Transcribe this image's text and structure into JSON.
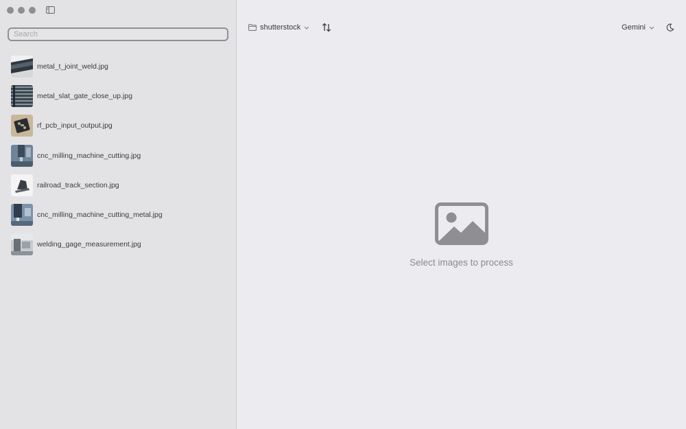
{
  "window": {
    "traffic_lights": [
      "close",
      "minimize",
      "zoom"
    ],
    "sidebar_toggle_icon": "sidebar-icon"
  },
  "sidebar": {
    "search": {
      "placeholder": "Search",
      "value": ""
    },
    "files": [
      {
        "name": "metal_t_joint_weld.jpg"
      },
      {
        "name": "metal_slat_gate_close_up.jpg"
      },
      {
        "name": "rf_pcb_input_output.jpg"
      },
      {
        "name": "cnc_milling_machine_cutting.jpg"
      },
      {
        "name": "railroad_track_section.jpg"
      },
      {
        "name": "cnc_milling_machine_cutting_metal.jpg"
      },
      {
        "name": "welding_gage_measurement.jpg"
      }
    ]
  },
  "toolbar": {
    "folder_label": "shutterstock",
    "folder_icon": "folder-icon",
    "sort_icon": "sort-arrows-icon",
    "model_label": "Gemini",
    "theme_icon": "moon-icon"
  },
  "main": {
    "empty_icon": "image-placeholder-icon",
    "empty_text": "Select images to process"
  },
  "colors": {
    "sidebar_bg": "#e3e3e6",
    "main_bg": "#ebebf0",
    "text": "#3a3a3c",
    "muted": "#8a8a8f",
    "traffic_light": "#8e8e93"
  }
}
